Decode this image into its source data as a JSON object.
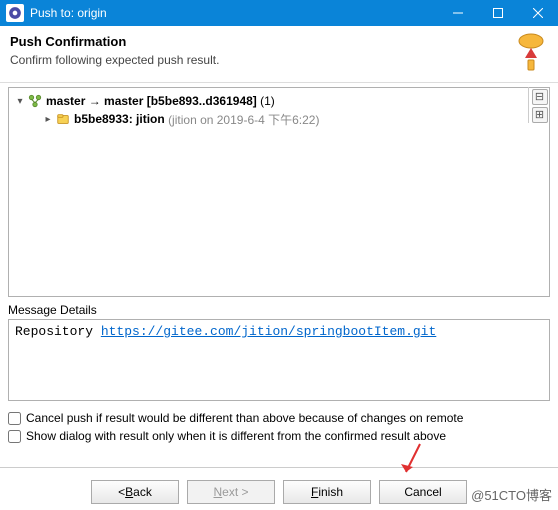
{
  "window": {
    "title": "Push to: origin"
  },
  "header": {
    "title": "Push Confirmation",
    "subtitle": "Confirm following expected push result."
  },
  "tree": {
    "root": {
      "label_bold": "master → master",
      "label_range": "[b5be893..d361948]",
      "label_count": "(1)"
    },
    "child": {
      "hash": "b5be8933:",
      "msg": "jition",
      "meta": "(jition on 2019-6-4 下午6:22)"
    }
  },
  "side": {
    "collapse": "⊟",
    "expand": "⊞"
  },
  "message": {
    "label": "Message Details",
    "prefix": "Repository ",
    "url": "https://gitee.com/jition/springbootItem.git"
  },
  "checks": {
    "cancel": "Cancel push if result would be different than above because of changes on remote",
    "show": "Show dialog with result only when it is different from the confirmed result above"
  },
  "buttons": {
    "back_sym": "< ",
    "back_u": "B",
    "back_rest": "ack",
    "next_u": "N",
    "next_rest": "ext >",
    "finish_pre": "",
    "finish_u": "F",
    "finish_rest": "inish",
    "cancel": "Cancel"
  },
  "watermark": "@51CTO博客"
}
